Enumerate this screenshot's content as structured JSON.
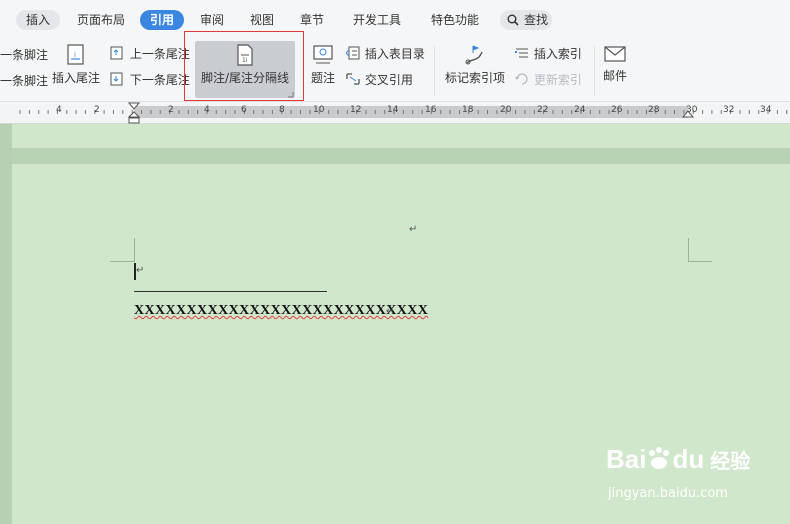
{
  "tabs": [
    {
      "id": "insert",
      "label": "插入"
    },
    {
      "id": "layout",
      "label": "页面布局"
    },
    {
      "id": "references",
      "label": "引用",
      "active": true
    },
    {
      "id": "review",
      "label": "审阅"
    },
    {
      "id": "view",
      "label": "视图"
    },
    {
      "id": "section",
      "label": "章节"
    },
    {
      "id": "developer",
      "label": "开发工具"
    },
    {
      "id": "special",
      "label": "特色功能"
    }
  ],
  "search_label": "查找",
  "ribbon": {
    "prev_footnote": "一条脚注",
    "next_footnote": "一条脚注",
    "insert_endnote": "插入尾注",
    "prev_endnote": "上一条尾注",
    "next_endnote": "下一条尾注",
    "separator": "脚注/尾注分隔线",
    "caption": "题注",
    "insert_toc": "插入表目录",
    "cross_ref": "交叉引用",
    "mark_index": "标记索引项",
    "insert_index": "插入索引",
    "update_index": "更新索引",
    "mail": "邮件"
  },
  "ruler": [
    "4",
    "2",
    "2",
    "4",
    "6",
    "8",
    "10",
    "12",
    "14",
    "16",
    "18",
    "20",
    "22",
    "24",
    "26",
    "28",
    "30",
    "32",
    "34"
  ],
  "document": {
    "footnote_text": "XXXXXXXXXXXXXXXXXXXXXXXXXXXX",
    "para_mark": "↵"
  },
  "watermark": {
    "brand": "Bai",
    "brand2": "du",
    "cn": "经验",
    "url": "jingyan.baidu.com"
  },
  "colors": {
    "accent": "#3b86e0",
    "doc_background": "#d0e7cc",
    "highlight_border": "#e03a3a"
  }
}
